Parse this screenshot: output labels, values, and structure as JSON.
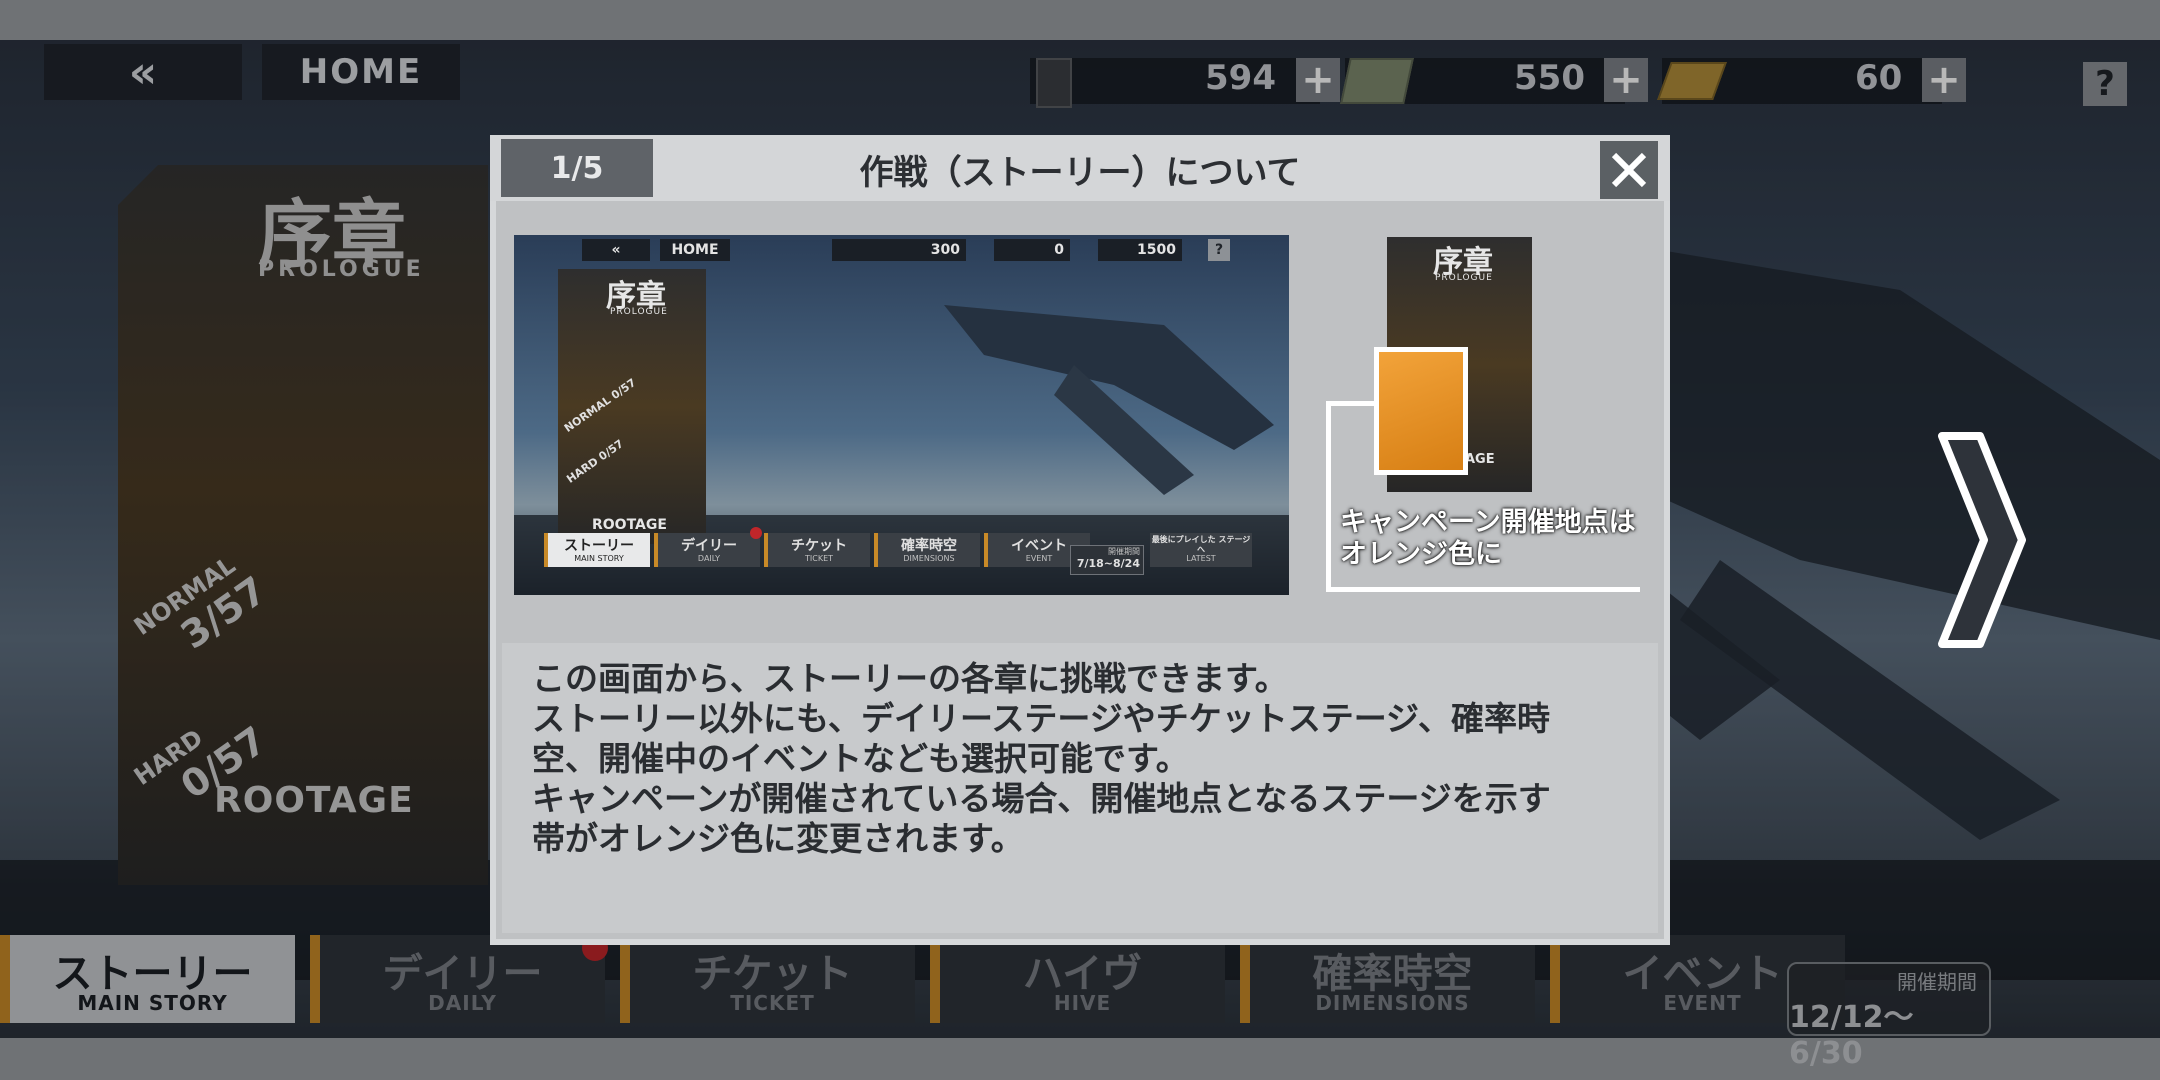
{
  "topbar": {
    "back_label": "«",
    "home_label": "HOME",
    "currencies": [
      {
        "icon": "crate-icon",
        "value": "594"
      },
      {
        "icon": "cash-icon",
        "value": "550"
      },
      {
        "icon": "gold-bar-icon",
        "value": "60"
      }
    ],
    "plus_label": "+",
    "help_label": "?"
  },
  "chapter_card": {
    "kanji": "序章",
    "subtitle": "PROLOGUE",
    "normal_label": "NORMAL",
    "normal_value": "3/57",
    "hard_label": "HARD",
    "hard_value": "0/57",
    "footer": "ROOTAGE"
  },
  "tabs": [
    {
      "jp": "ストーリー",
      "en": "MAIN STORY",
      "active": true
    },
    {
      "jp": "デイリー",
      "en": "DAILY",
      "badge": true
    },
    {
      "jp": "チケット",
      "en": "TICKET"
    },
    {
      "jp": "ハイヴ",
      "en": "HIVE"
    },
    {
      "jp": "確率時空",
      "en": "DIMENSIONS"
    },
    {
      "jp": "イベント",
      "en": "EVENT"
    }
  ],
  "period": {
    "label": "開催期間",
    "value": "12/12～6/30"
  },
  "modal": {
    "page": "1/5",
    "title": "作戦（ストーリー）について",
    "close_label": "✕",
    "preview": {
      "back_label": "«",
      "home_label": "HOME",
      "currencies": [
        "300",
        "0",
        "1500"
      ],
      "help_label": "?",
      "card_kanji": "序章",
      "card_subtitle": "PROLOGUE",
      "card_normal": "NORMAL 0/57",
      "card_hard": "HARD 0/57",
      "card_footer": "ROOTAGE",
      "tabs": [
        {
          "a": "ストーリー",
          "b": "MAIN STORY"
        },
        {
          "a": "デイリー",
          "b": "DAILY"
        },
        {
          "a": "チケット",
          "b": "TICKET"
        },
        {
          "a": "確率時空",
          "b": "DIMENSIONS"
        },
        {
          "a": "イベント",
          "b": "EVENT"
        },
        {
          "a": "最後にプレイした ステージへ",
          "b": "LATEST"
        }
      ],
      "period_label": "開催期間",
      "period_value": "7/18~8/24"
    },
    "side_card": {
      "kanji": "序章",
      "subtitle": "PROLOGUE",
      "footer": "ROOTAGE"
    },
    "highlight_text_1": "キャンペーン開催地点は",
    "highlight_text_2": "オレンジ色に",
    "description": [
      "この画面から、ストーリーの各章に挑戦できます。",
      "ストーリー以外にも、デイリーステージやチケットステージ、確率時",
      "空、開催中のイベントなども選択可能です。",
      "キャンペーンが開催されている場合、開催地点となるステージを示す",
      "帯がオレンジ色に変更されます。"
    ]
  },
  "colors": {
    "accent": "#c88a28",
    "badge": "#c0262a",
    "highlight": "#f2a33a"
  }
}
